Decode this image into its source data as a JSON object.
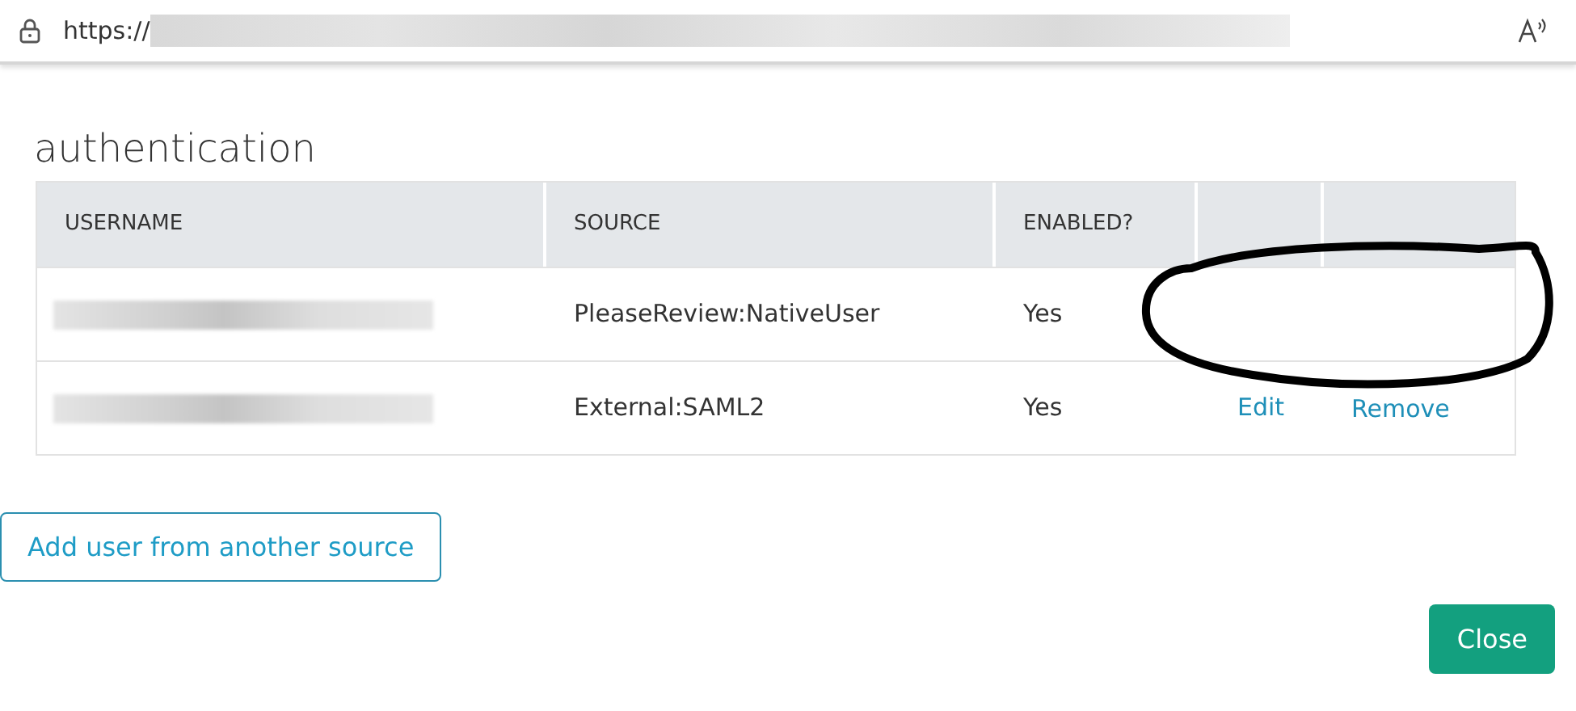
{
  "address_bar": {
    "url": "https://"
  },
  "title": "authentication",
  "table": {
    "columns": [
      "USERNAME",
      "SOURCE",
      "ENABLED?"
    ],
    "rows": [
      {
        "source": "PleaseReview:NativeUser",
        "enabled": "Yes"
      },
      {
        "source": "External:SAML2",
        "enabled": "Yes",
        "actions": [
          "Edit",
          "Remove"
        ]
      }
    ]
  },
  "buttons": [
    {
      "label": "Add user from another source",
      "kind": "outline"
    },
    {
      "label": "Close",
      "kind": "primary"
    }
  ]
}
